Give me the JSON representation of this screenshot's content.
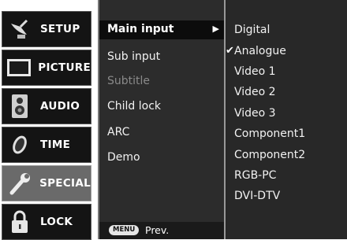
{
  "sidebar": {
    "items": [
      {
        "label": "SETUP",
        "icon": "satellite-dish-icon"
      },
      {
        "label": "PICTURE",
        "icon": "tv-screen-icon"
      },
      {
        "label": "AUDIO",
        "icon": "speaker-icon"
      },
      {
        "label": "TIME",
        "icon": "clock-icon"
      },
      {
        "label": "SPECIAL",
        "icon": "wrench-icon",
        "active": true
      },
      {
        "label": "LOCK",
        "icon": "padlock-icon"
      }
    ]
  },
  "submenu": {
    "selected": "Main input",
    "items": [
      "Sub input",
      "Subtitle",
      "Child lock",
      "ARC",
      "Demo"
    ],
    "disabled": [
      "Subtitle"
    ],
    "bottom": {
      "key_label": "MENU",
      "action": "Prev."
    }
  },
  "options": {
    "items": [
      "Digital",
      "Analogue",
      "Video 1",
      "Video 2",
      "Video 3",
      "Component1",
      "Component2",
      "RGB-PC",
      "DVI-DTV"
    ],
    "checked": "Analogue",
    "check_mark": "✔"
  }
}
